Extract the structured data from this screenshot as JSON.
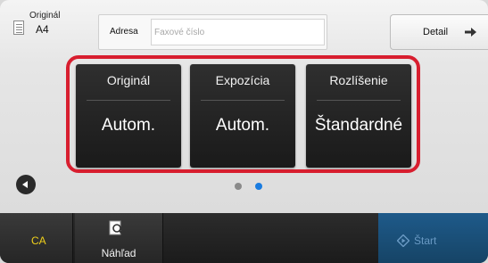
{
  "original": {
    "label": "Originál",
    "size": "A4"
  },
  "address": {
    "label": "Adresa",
    "placeholder": "Faxové číslo"
  },
  "detail": {
    "label": "Detail"
  },
  "tiles": [
    {
      "header": "Originál",
      "value": "Autom."
    },
    {
      "header": "Expozícia",
      "value": "Autom."
    },
    {
      "header": "Rozlíšenie",
      "value": "Štandardné"
    }
  ],
  "pagination": {
    "total_pages": 2,
    "current_page": 2
  },
  "bottom": {
    "ca_label": "CA",
    "preview_label": "Náhľad",
    "start_label": "Štart"
  },
  "colors": {
    "panel_border": "#d81e2f",
    "active_dot": "#1a7ce0",
    "ca_text": "#f0d01a",
    "start_bg": "#1e5a8a"
  }
}
